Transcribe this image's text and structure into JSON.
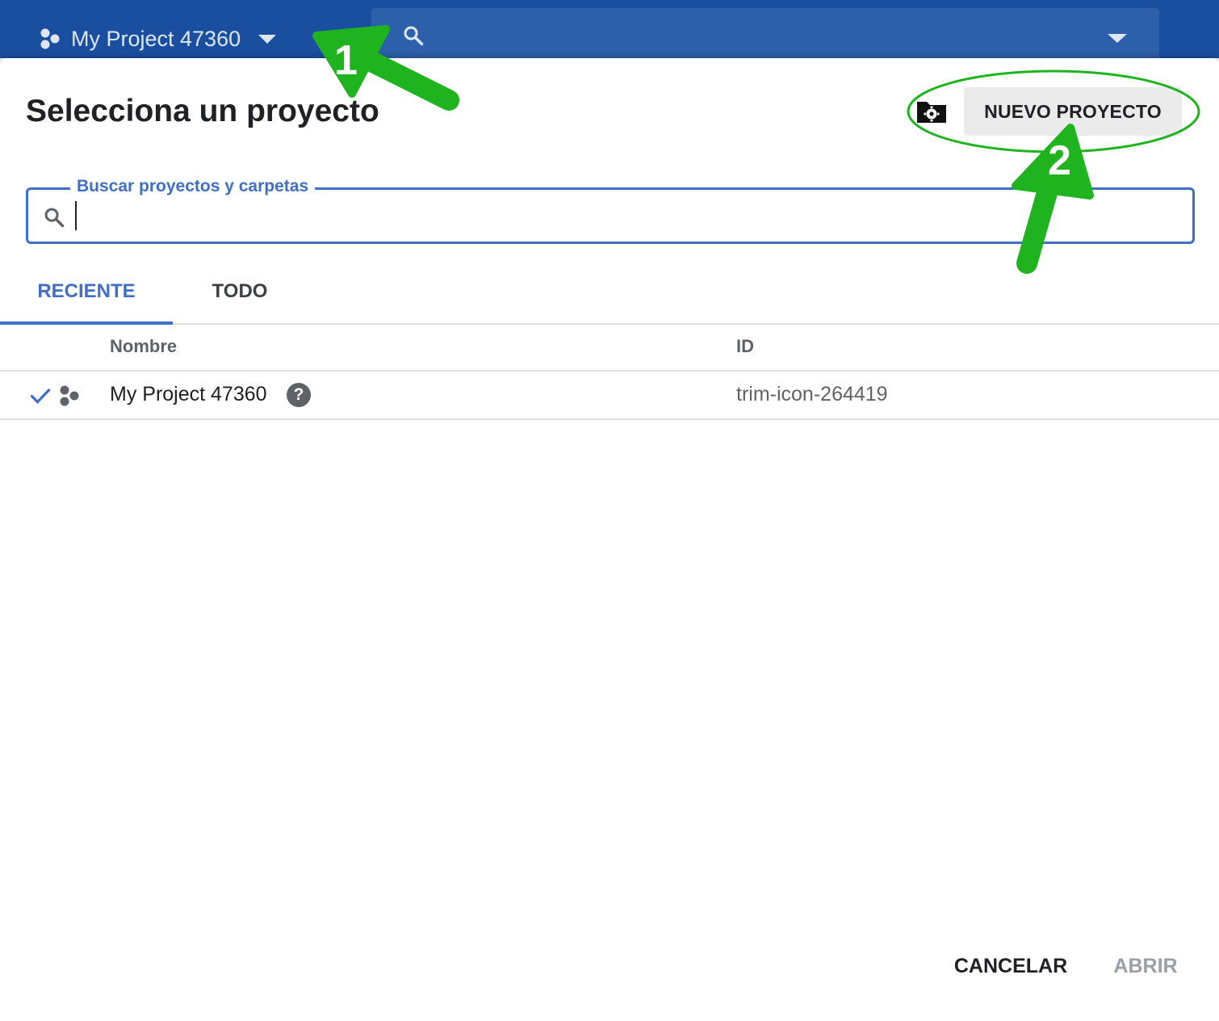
{
  "topbar": {
    "project_name": "My Project 47360",
    "hex_icon": "project-hex-icon",
    "search_icon": "search-icon",
    "dropdown_icon": "chevron-down-icon"
  },
  "dialog": {
    "title": "Selecciona un proyecto",
    "folder_icon": "folder-gear-icon",
    "new_project_label": "NUEVO PROYECTO",
    "search": {
      "label": "Buscar proyectos y carpetas",
      "value": "",
      "placeholder": ""
    },
    "tabs": [
      {
        "label": "RECIENTE",
        "active": true
      },
      {
        "label": "TODO",
        "active": false
      }
    ],
    "table": {
      "columns": [
        "Nombre",
        "ID"
      ],
      "rows": [
        {
          "name": "My Project 47360",
          "id": "trim-icon-264419",
          "selected": true,
          "help": "?"
        }
      ]
    },
    "footer": {
      "cancel_label": "CANCELAR",
      "open_label": "ABRIR"
    }
  },
  "annotations": {
    "marker_1": "1",
    "marker_2": "2",
    "color": "#1fb41f"
  },
  "colors": {
    "topbar": "#1a4fa0",
    "accent": "#3f6fc6",
    "disabled": "#9aa0a6"
  }
}
